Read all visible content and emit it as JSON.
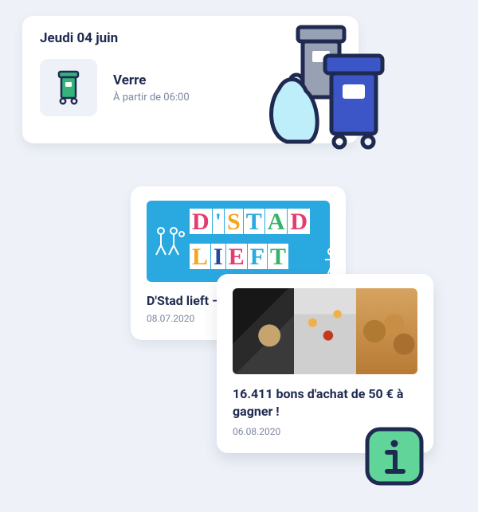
{
  "card1": {
    "date": "Jeudi 04 juin",
    "title": "Verre",
    "subtitle": "À partir de 06:00"
  },
  "card2": {
    "title": "D'Stad lieft – m",
    "date": "08.07.2020",
    "banner_line1": "D'STAD",
    "banner_line2": "LIEFT"
  },
  "card3": {
    "title": "16.411 bons d'achat de 50 € à gagner !",
    "date": "06.08.2020"
  },
  "colors": {
    "dstad": [
      "#e63b6e",
      "#2aa9e0",
      "#f4a51c",
      "#2aa9e0",
      "#33b36b",
      "#e63b6e"
    ],
    "lieft": [
      "#f4a51c",
      "#264a9a",
      "#e63b6e",
      "#2aa9e0",
      "#33b36b"
    ]
  }
}
